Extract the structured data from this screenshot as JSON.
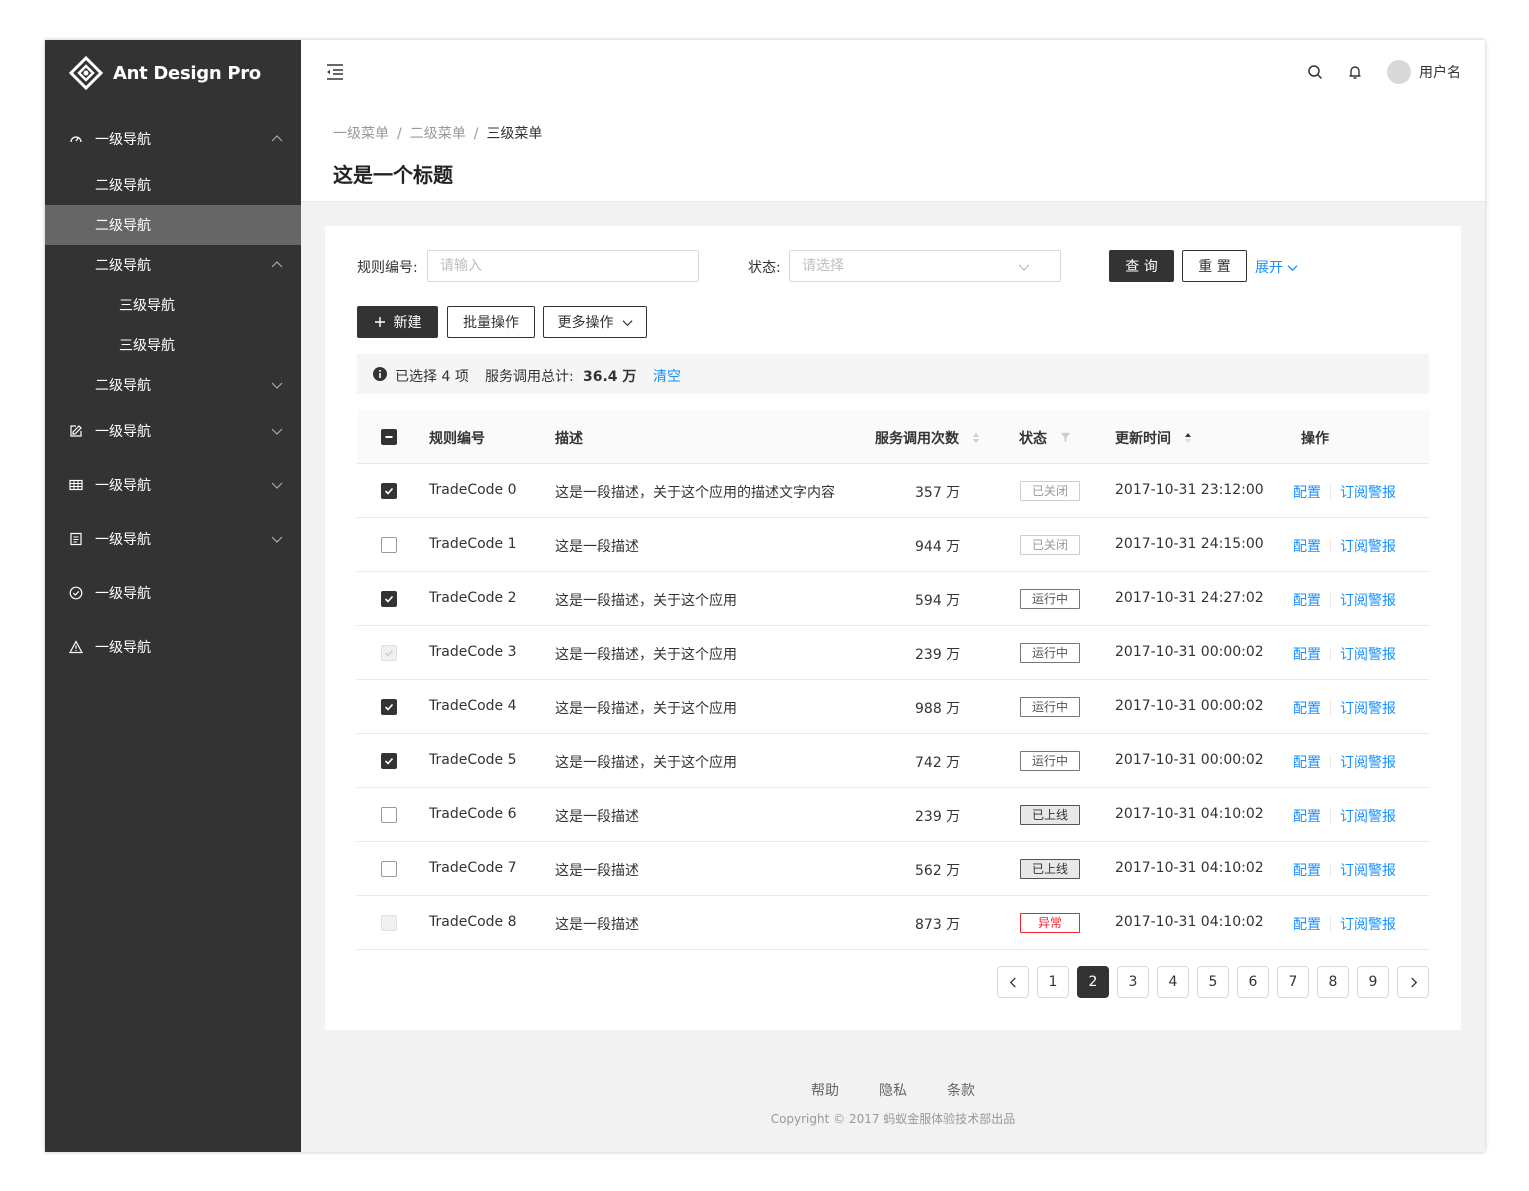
{
  "brand": {
    "name": "Ant Design Pro"
  },
  "sidebar": {
    "items": [
      {
        "label": "一级导航",
        "icon": "dashboard-icon",
        "arrow": "up"
      },
      {
        "label": "二级导航"
      },
      {
        "label": "二级导航",
        "active": true
      },
      {
        "label": "二级导航",
        "arrow": "up"
      },
      {
        "label": "三级导航"
      },
      {
        "label": "三级导航"
      },
      {
        "label": "二级导航",
        "arrow": "down"
      },
      {
        "label": "一级导航",
        "icon": "form-icon",
        "arrow": "down"
      },
      {
        "label": "一级导航",
        "icon": "table-icon",
        "arrow": "down"
      },
      {
        "label": "一级导航",
        "icon": "profile-icon",
        "arrow": "down"
      },
      {
        "label": "一级导航",
        "icon": "check-circle-icon"
      },
      {
        "label": "一级导航",
        "icon": "warning-icon"
      }
    ]
  },
  "header": {
    "username": "用户名"
  },
  "breadcrumb": [
    "一级菜单",
    "二级菜单",
    "三级菜单"
  ],
  "page_title": "这是一个标题",
  "filters": {
    "rule_label": "规则编号:",
    "rule_placeholder": "请输入",
    "status_label": "状态:",
    "status_placeholder": "请选择",
    "query": "查 询",
    "reset": "重 置",
    "expand": "展开"
  },
  "toolbar": {
    "new": "新建",
    "batch": "批量操作",
    "more": "更多操作"
  },
  "selection": {
    "selected_prefix": "已选择",
    "selected_count": "4",
    "selected_suffix": "项",
    "total_label": "服务调用总计:",
    "total_value": "36.4 万",
    "clear": "清空"
  },
  "table": {
    "columns": [
      "规则编号",
      "描述",
      "服务调用次数",
      "状态",
      "更新时间",
      "操作"
    ],
    "rows": [
      {
        "code": "TradeCode 0",
        "desc": "这是一段描述，关于这个应用的描述文字内容",
        "calls": "357 万",
        "status": "已关闭",
        "status_kind": "closed",
        "time": "2017-10-31  23:12:00",
        "checked": "on"
      },
      {
        "code": "TradeCode 1",
        "desc": "这是一段描述",
        "calls": "944 万",
        "status": "已关闭",
        "status_kind": "closed",
        "time": "2017-10-31  24:15:00",
        "checked": "off"
      },
      {
        "code": "TradeCode 2",
        "desc": "这是一段描述，关于这个应用",
        "calls": "594 万",
        "status": "运行中",
        "status_kind": "run",
        "time": "2017-10-31  24:27:02",
        "checked": "on"
      },
      {
        "code": "TradeCode 3",
        "desc": "这是一段描述，关于这个应用",
        "calls": "239 万",
        "status": "运行中",
        "status_kind": "run",
        "time": "2017-10-31  00:00:02",
        "checked": "disabled-on"
      },
      {
        "code": "TradeCode 4",
        "desc": "这是一段描述，关于这个应用",
        "calls": "988 万",
        "status": "运行中",
        "status_kind": "run",
        "time": "2017-10-31  00:00:02",
        "checked": "on"
      },
      {
        "code": "TradeCode 5",
        "desc": "这是一段描述，关于这个应用",
        "calls": "742 万",
        "status": "运行中",
        "status_kind": "run",
        "time": "2017-10-31  00:00:02",
        "checked": "on"
      },
      {
        "code": "TradeCode 6",
        "desc": "这是一段描述",
        "calls": "239 万",
        "status": "已上线",
        "status_kind": "online",
        "time": "2017-10-31  04:10:02",
        "checked": "off"
      },
      {
        "code": "TradeCode 7",
        "desc": "这是一段描述",
        "calls": "562 万",
        "status": "已上线",
        "status_kind": "online",
        "time": "2017-10-31  04:10:02",
        "checked": "off"
      },
      {
        "code": "TradeCode 8",
        "desc": "这是一段描述",
        "calls": "873 万",
        "status": "异常",
        "status_kind": "err",
        "time": "2017-10-31  04:10:02",
        "checked": "disabled"
      }
    ],
    "op_config": "配置",
    "op_subscribe": "订阅警报"
  },
  "pagination": {
    "pages": [
      "1",
      "2",
      "3",
      "4",
      "5",
      "6",
      "7",
      "8",
      "9"
    ],
    "current": "2"
  },
  "footer": {
    "links": [
      "帮助",
      "隐私",
      "条款"
    ],
    "copyright": "Copyright © 2017 蚂蚁金服体验技术部出品"
  }
}
